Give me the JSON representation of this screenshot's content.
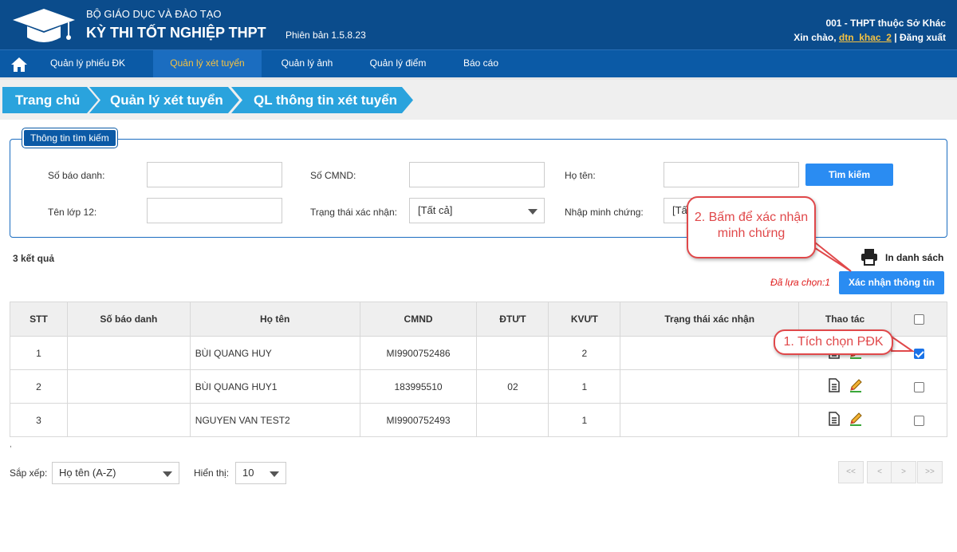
{
  "header": {
    "org": "BỘ GIÁO DỤC VÀ ĐÀO TẠO",
    "exam_title": "KỲ THI TỐT NGHIỆP THPT",
    "version": "Phiên bản 1.5.8.23",
    "school": "001 - THPT thuộc Sở Khác",
    "greeting": "Xin chào,",
    "username": "dtn_khac_2",
    "separator": "|",
    "logout": "Đăng xuất"
  },
  "nav": {
    "items": [
      {
        "label": "Quản lý phiếu ĐK"
      },
      {
        "label": "Quản lý xét tuyển"
      },
      {
        "label": "Quản lý ảnh"
      },
      {
        "label": "Quản lý điểm"
      },
      {
        "label": "Báo cáo"
      }
    ],
    "active_index": 1
  },
  "breadcrumb": [
    "Trang chủ",
    "Quản lý xét tuyển",
    "QL thông tin xét tuyển"
  ],
  "search": {
    "legend": "Thông tin tìm kiếm",
    "sbd_label": "Số báo danh:",
    "sbd_value": "",
    "cmnd_label": "Số CMND:",
    "cmnd_value": "",
    "name_label": "Họ tên:",
    "name_value": "",
    "search_button": "Tìm kiếm",
    "class_label": "Tên lớp 12:",
    "class_value": "",
    "status_label": "Trạng thái xác nhận:",
    "status_value": "[Tất cả]",
    "evidence_label": "Nhập minh chứng:",
    "evidence_value": "[Tấ"
  },
  "results": {
    "count_text": "3 kết quả",
    "print_label": "In danh sách",
    "selected_text": "Đã lựa chọn:1",
    "confirm_button": "Xác nhận thông tin"
  },
  "table": {
    "headers": [
      "STT",
      "Số báo danh",
      "Họ tên",
      "CMND",
      "ĐTƯT",
      "KVƯT",
      "Trạng thái xác nhận",
      "Thao tác",
      ""
    ],
    "rows": [
      {
        "stt": "1",
        "sbd": "",
        "name": "BÙI QUANG HUY",
        "cmnd": "MI9900752486",
        "dtut": "",
        "kvut": "2",
        "status": "",
        "checked": true
      },
      {
        "stt": "2",
        "sbd": "",
        "name": "BÙI QUANG HUY1",
        "cmnd": "183995510",
        "dtut": "02",
        "kvut": "1",
        "status": "",
        "checked": false
      },
      {
        "stt": "3",
        "sbd": "",
        "name": "NGUYEN VAN TEST2",
        "cmnd": "MI9900752493",
        "dtut": "",
        "kvut": "1",
        "status": "",
        "checked": false
      }
    ]
  },
  "footer": {
    "dot": ",",
    "sort_label": "Sắp xếp:",
    "sort_value": "Họ tên (A-Z)",
    "show_label": "Hiển thị:",
    "show_value": "10",
    "pager": [
      "<<",
      "<",
      ">",
      ">>"
    ]
  },
  "callouts": {
    "step1": "1. Tích chọn PĐK",
    "step2": "2. Bấm để xác nhận minh chứng"
  },
  "colors": {
    "header_bg": "#0b4c8c",
    "nav_bg": "#0b5aa6",
    "accent": "#2aa3dd",
    "active_text": "#f5c242",
    "button": "#2a8cf2",
    "callout": "#e0484a"
  }
}
